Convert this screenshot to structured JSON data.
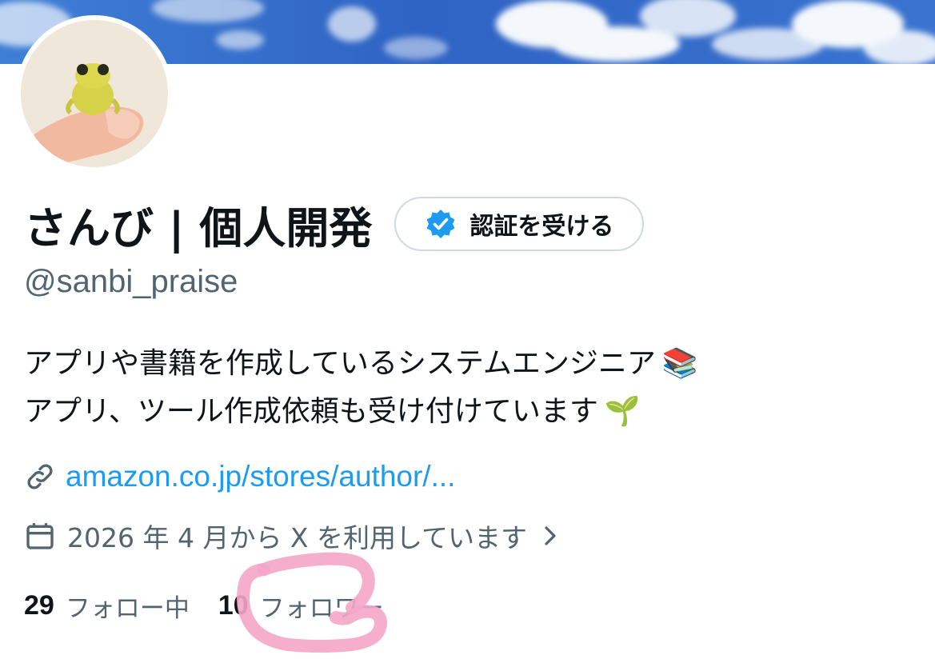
{
  "profile": {
    "display_name": "さんび | 個人開発",
    "handle": "@sanbi_praise",
    "verify_button_label": "認証を受ける",
    "bio_lines": [
      "アプリや書籍を作成しているシステムエンジニア",
      "アプリ、ツール作成依頼も受け付けています"
    ],
    "bio_emojis": [
      "📚",
      "🌱"
    ],
    "link_text": "amazon.co.jp/stores/author/...",
    "joined_text": "2026 年 4 月から X を利用しています",
    "stats": {
      "following_count": "29",
      "following_label": "フォロー中",
      "followers_count": "10",
      "followers_label": "フォロワー"
    }
  },
  "icons": {
    "verify": "verified-badge-icon",
    "link": "link-icon",
    "calendar": "calendar-icon",
    "chevron": "chevron-right-icon"
  },
  "colors": {
    "accent": "#1d9bf0",
    "text_primary": "#0f1419",
    "text_secondary": "#536471",
    "border": "#cfd9de",
    "highlight": "#f4a6c8"
  }
}
